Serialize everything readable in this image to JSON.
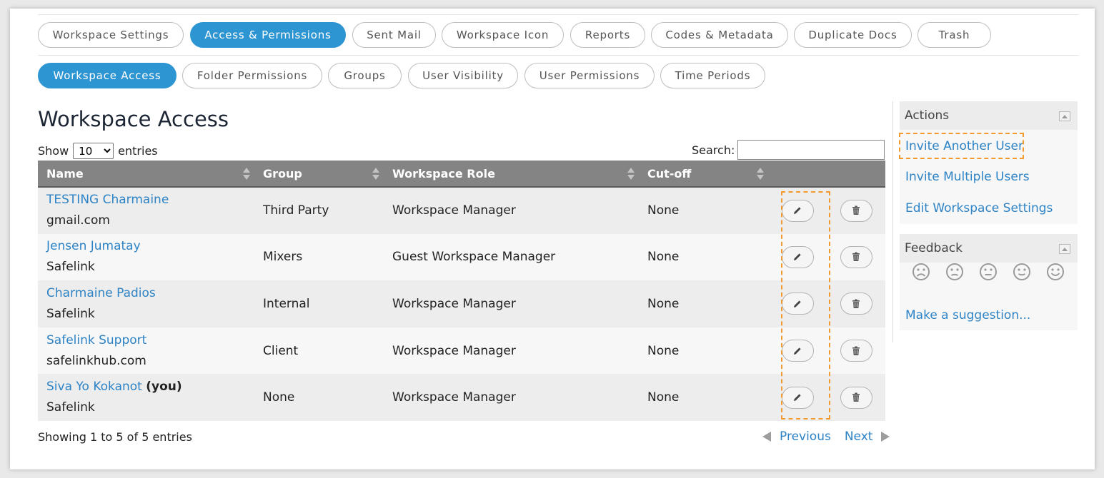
{
  "tabs": [
    {
      "label": "Workspace Settings",
      "active": false
    },
    {
      "label": "Access & Permissions",
      "active": true
    },
    {
      "label": "Sent Mail",
      "active": false
    },
    {
      "label": "Workspace Icon",
      "active": false
    },
    {
      "label": "Reports",
      "active": false
    },
    {
      "label": "Codes & Metadata",
      "active": false
    },
    {
      "label": "Duplicate Docs",
      "active": false
    },
    {
      "label": "Trash",
      "active": false
    }
  ],
  "subtabs": [
    {
      "label": "Workspace Access",
      "active": true
    },
    {
      "label": "Folder Permissions",
      "active": false
    },
    {
      "label": "Groups",
      "active": false
    },
    {
      "label": "User Visibility",
      "active": false
    },
    {
      "label": "User Permissions",
      "active": false
    },
    {
      "label": "Time Periods",
      "active": false
    }
  ],
  "page": {
    "title": "Workspace Access"
  },
  "controls": {
    "show_label": "Show",
    "entries_value": "10",
    "entries_label": "entries",
    "search_label": "Search:",
    "search_value": ""
  },
  "table": {
    "headers": [
      "Name",
      "Group",
      "Workspace Role",
      "Cut-off"
    ],
    "rows": [
      {
        "name": "TESTING Charmaine",
        "you": "",
        "org": "gmail.com",
        "group": "Third Party",
        "role": "Workspace Manager",
        "cutoff": "None"
      },
      {
        "name": "Jensen Jumatay",
        "you": "",
        "org": "Safelink",
        "group": "Mixers",
        "role": "Guest Workspace Manager",
        "cutoff": "None"
      },
      {
        "name": "Charmaine Padios",
        "you": "",
        "org": "Safelink",
        "group": "Internal",
        "role": "Workspace Manager",
        "cutoff": "None"
      },
      {
        "name": "Safelink Support",
        "you": "",
        "org": "safelinkhub.com",
        "group": "Client",
        "role": "Workspace Manager",
        "cutoff": "None"
      },
      {
        "name": "Siva Yo Kokanot",
        "you": "(you)",
        "org": "Safelink",
        "group": "None",
        "role": "Workspace Manager",
        "cutoff": "None"
      }
    ]
  },
  "footer": {
    "info": "Showing 1 to 5 of 5 entries",
    "previous": "Previous",
    "next": "Next"
  },
  "actions_panel": {
    "title": "Actions",
    "links": [
      "Invite Another User",
      "Invite Multiple Users",
      "Edit Workspace Settings"
    ]
  },
  "feedback_panel": {
    "title": "Feedback",
    "faces": [
      "very-sad-face-icon",
      "sad-face-icon",
      "neutral-face-icon",
      "smile-face-icon",
      "happy-face-icon"
    ],
    "suggestion": "Make a suggestion..."
  },
  "colors": {
    "accent": "#2e95d3",
    "link": "#2d83c5",
    "highlight": "#f29a2e",
    "header_bg": "#848484"
  },
  "icons": {
    "edit": "pencil-icon",
    "delete": "trash-icon"
  }
}
